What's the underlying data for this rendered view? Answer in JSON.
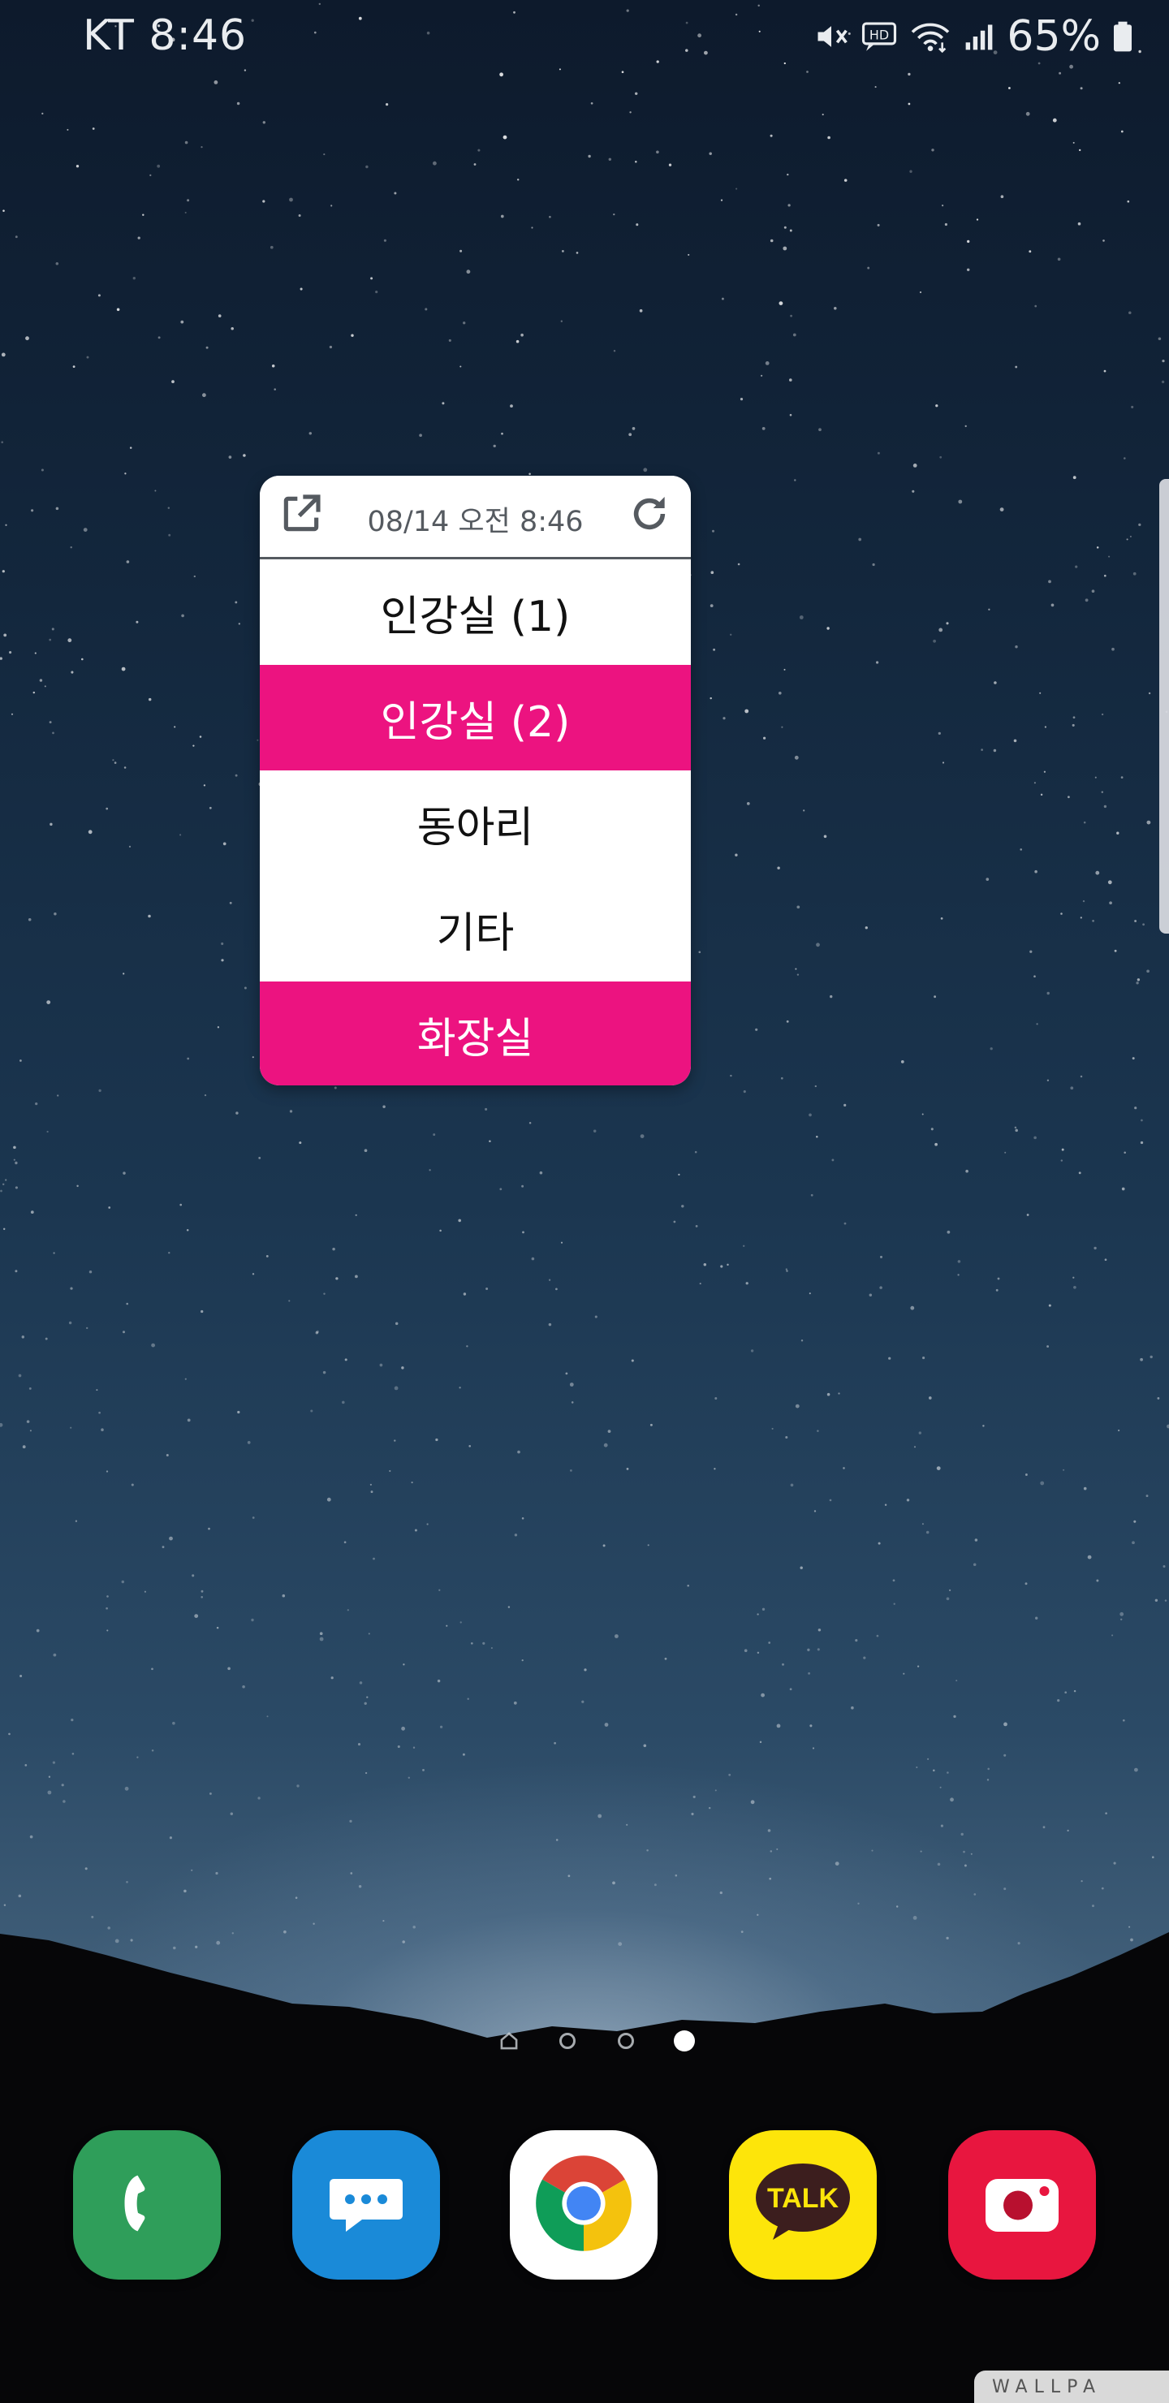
{
  "status_bar": {
    "carrier_time": "KT 8:46",
    "battery": "65%",
    "icons": [
      "mute-icon",
      "hd-icon",
      "wifi-icon",
      "signal-icon",
      "battery-icon"
    ]
  },
  "widget": {
    "updated": "08/14 오전 8:46",
    "open_icon": "external-link-icon",
    "refresh_icon": "refresh-icon",
    "items": [
      {
        "label": "인강실 (1)",
        "active": false
      },
      {
        "label": "인강실 (2)",
        "active": true
      },
      {
        "label": "동아리",
        "active": false
      },
      {
        "label": "기타",
        "active": false
      },
      {
        "label": "화장실",
        "active": true
      }
    ],
    "colors": {
      "active": "#ec1380",
      "inactive": "#ffffff"
    }
  },
  "home": {
    "pages": 3,
    "current_page": 3,
    "dock": [
      "phone-icon",
      "messages-icon",
      "chrome-icon",
      "kakaotalk-icon",
      "camera-icon"
    ],
    "kakao_label": "TALK"
  },
  "watermark": "WALLPA"
}
